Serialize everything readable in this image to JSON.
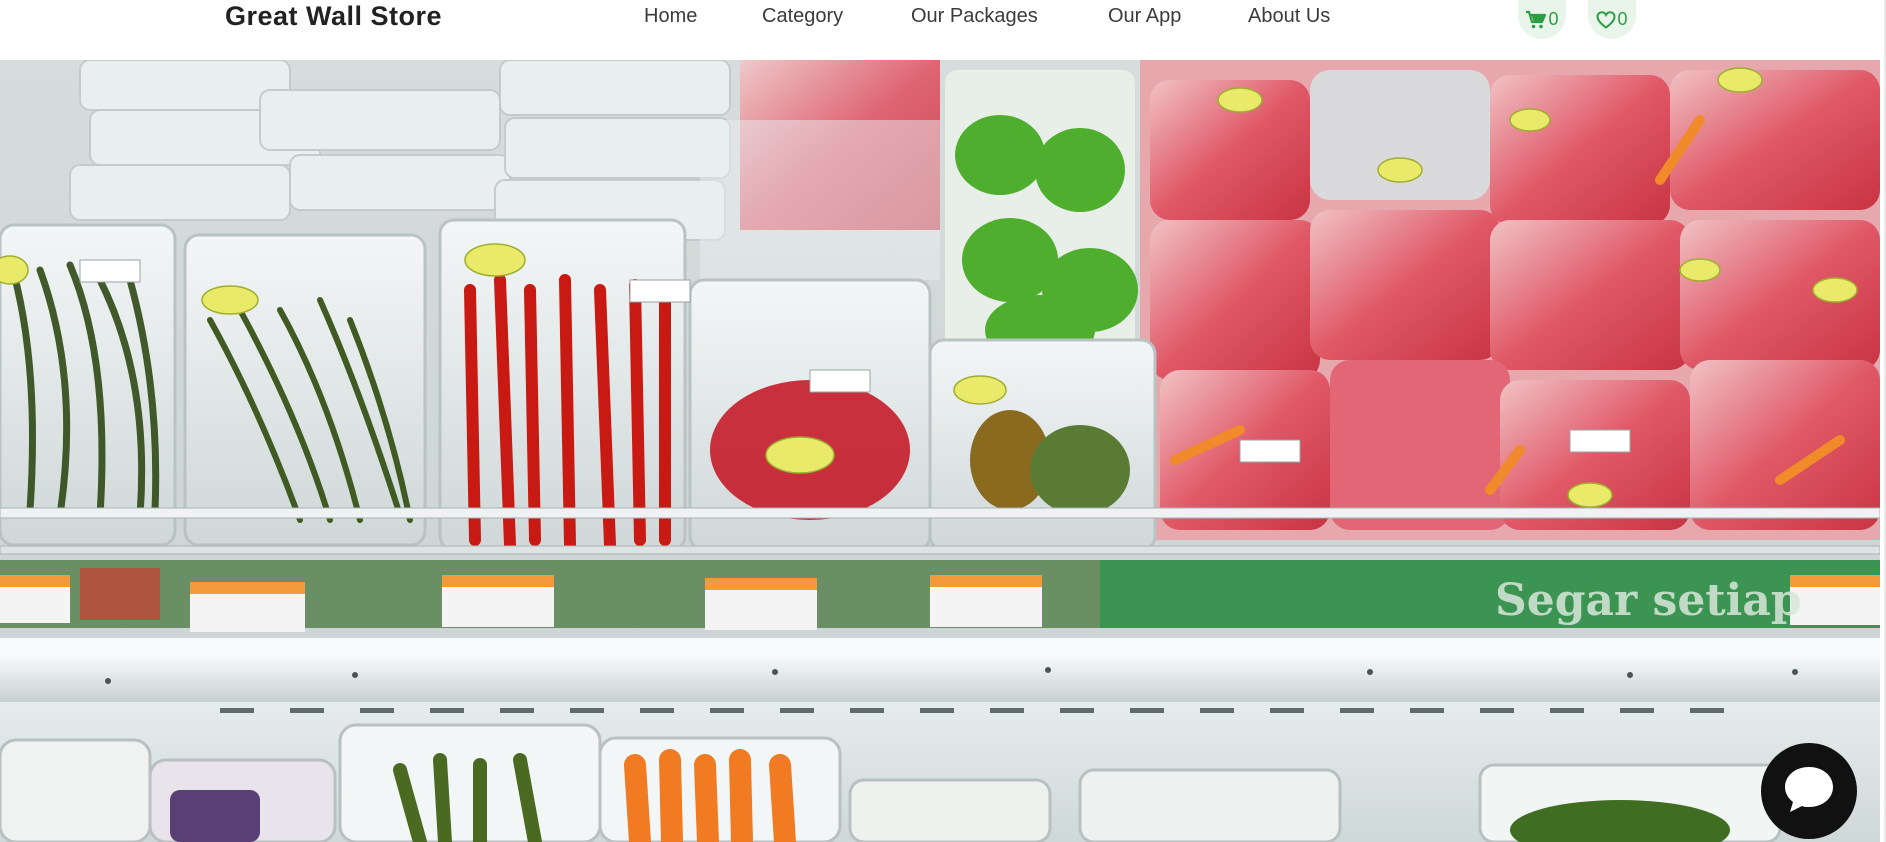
{
  "header": {
    "brand": "Great Wall Store",
    "nav": [
      {
        "label": "Home"
      },
      {
        "label": "Category"
      },
      {
        "label": "Our Packages"
      },
      {
        "label": "Our App"
      },
      {
        "label": "About Us"
      }
    ],
    "cart": {
      "icon": "cart-icon",
      "count": "0"
    },
    "wishlist": {
      "icon": "heart-icon",
      "count": "0"
    }
  },
  "hero": {
    "alt": "supermarket vegetable shelf",
    "shelf_banner": "Segar setiap"
  },
  "chat": {
    "icon": "chat-bubble-icon"
  },
  "colors": {
    "accent_green": "#2e9e44",
    "pill_bg": "#e9f5ea",
    "chat_button": "#111111"
  }
}
